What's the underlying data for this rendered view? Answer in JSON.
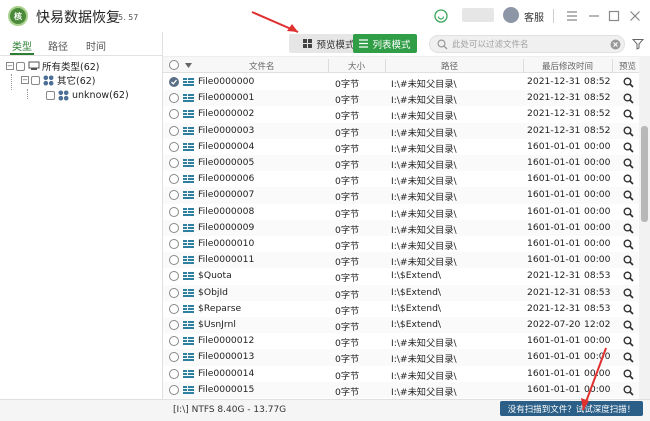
{
  "app": {
    "title": "快易数据恢复",
    "version": "5. 57",
    "logo_text": "核"
  },
  "titlebar": {
    "service_label": "客服"
  },
  "left_tabs": [
    "类型",
    "路径",
    "时间"
  ],
  "tree": [
    {
      "label": "所有类型(62)"
    },
    {
      "label": "其它(62)"
    },
    {
      "label": "unknow(62)"
    }
  ],
  "toolbar": {
    "preview_mode": "预览模式",
    "list_mode": "列表模式",
    "search_placeholder": "此处可以过滤文件名"
  },
  "table": {
    "columns": [
      "文件名",
      "大小",
      "路径",
      "最后修改时间",
      "预览"
    ],
    "rows": [
      {
        "name": "File0000000",
        "size": "0字节",
        "path": "I:\\#未知父目录\\",
        "date": "2021-12-31",
        "time": "08:52",
        "checked": true
      },
      {
        "name": "File0000001",
        "size": "0字节",
        "path": "I:\\#未知父目录\\",
        "date": "2021-12-31",
        "time": "08:52",
        "checked": false
      },
      {
        "name": "File0000002",
        "size": "0字节",
        "path": "I:\\#未知父目录\\",
        "date": "2021-12-31",
        "time": "08:52",
        "checked": false
      },
      {
        "name": "File0000003",
        "size": "0字节",
        "path": "I:\\#未知父目录\\",
        "date": "2021-12-31",
        "time": "08:52",
        "checked": false
      },
      {
        "name": "File0000004",
        "size": "0字节",
        "path": "I:\\#未知父目录\\",
        "date": "1601-01-01",
        "time": "00:00",
        "checked": false
      },
      {
        "name": "File0000005",
        "size": "0字节",
        "path": "I:\\#未知父目录\\",
        "date": "1601-01-01",
        "time": "00:00",
        "checked": false
      },
      {
        "name": "File0000006",
        "size": "0字节",
        "path": "I:\\#未知父目录\\",
        "date": "1601-01-01",
        "time": "00:00",
        "checked": false
      },
      {
        "name": "File0000007",
        "size": "0字节",
        "path": "I:\\#未知父目录\\",
        "date": "1601-01-01",
        "time": "00:00",
        "checked": false
      },
      {
        "name": "File0000008",
        "size": "0字节",
        "path": "I:\\#未知父目录\\",
        "date": "1601-01-01",
        "time": "00:00",
        "checked": false
      },
      {
        "name": "File0000009",
        "size": "0字节",
        "path": "I:\\#未知父目录\\",
        "date": "1601-01-01",
        "time": "00:00",
        "checked": false
      },
      {
        "name": "File0000010",
        "size": "0字节",
        "path": "I:\\#未知父目录\\",
        "date": "1601-01-01",
        "time": "00:00",
        "checked": false
      },
      {
        "name": "File0000011",
        "size": "0字节",
        "path": "I:\\#未知父目录\\",
        "date": "1601-01-01",
        "time": "00:00",
        "checked": false
      },
      {
        "name": "$Quota",
        "size": "0字节",
        "path": "I:\\$Extend\\",
        "date": "2021-12-31",
        "time": "08:53",
        "checked": false
      },
      {
        "name": "$ObjId",
        "size": "0字节",
        "path": "I:\\$Extend\\",
        "date": "2021-12-31",
        "time": "08:53",
        "checked": false
      },
      {
        "name": "$Reparse",
        "size": "0字节",
        "path": "I:\\$Extend\\",
        "date": "2021-12-31",
        "time": "08:53",
        "checked": false
      },
      {
        "name": "$UsnJrnl",
        "size": "0字节",
        "path": "I:\\$Extend\\",
        "date": "2022-07-20",
        "time": "12:02",
        "checked": false
      },
      {
        "name": "File0000012",
        "size": "0字节",
        "path": "I:\\#未知父目录\\",
        "date": "1601-01-01",
        "time": "00:00",
        "checked": false
      },
      {
        "name": "File0000013",
        "size": "0字节",
        "path": "I:\\#未知父目录\\",
        "date": "1601-01-01",
        "time": "00:00",
        "checked": false
      },
      {
        "name": "File0000014",
        "size": "0字节",
        "path": "I:\\#未知父目录\\",
        "date": "1601-01-01",
        "time": "00:00",
        "checked": false
      },
      {
        "name": "File0000015",
        "size": "0字节",
        "path": "I:\\#未知父目录\\",
        "date": "1601-01-01",
        "time": "00:00",
        "checked": false
      }
    ]
  },
  "status": {
    "disk_info": "[I:\\] NTFS 8.40G - 13.77G",
    "deep_scan": "没有扫描到文件？试试深度扫描！"
  },
  "colors": {
    "accent": "#2f9e47",
    "annotation": "#e03030",
    "deep_scan": "#2b5f87"
  },
  "icons": [
    "search-icon",
    "preview-icon",
    "filter-icon",
    "grid-icon",
    "list-icon",
    "clear-icon",
    "menu-icon",
    "minimize-icon",
    "maximize-icon",
    "close-icon",
    "drive-icon"
  ]
}
